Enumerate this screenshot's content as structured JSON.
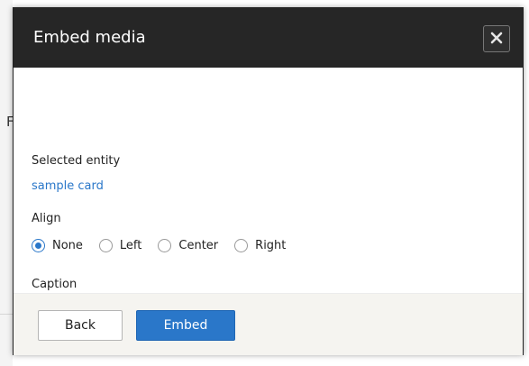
{
  "dialog": {
    "title": "Embed media",
    "close_label": "×"
  },
  "form": {
    "selected_entity_label": "Selected entity",
    "selected_entity_value": "sample card",
    "align_label": "Align",
    "align_options": [
      {
        "label": "None",
        "checked": true
      },
      {
        "label": "Left",
        "checked": false
      },
      {
        "label": "Center",
        "checked": false
      },
      {
        "label": "Right",
        "checked": false
      }
    ],
    "caption_label": "Caption",
    "caption_value": ""
  },
  "footer": {
    "back_label": "Back",
    "embed_label": "Embed"
  },
  "background": {
    "glyph": "F"
  },
  "colors": {
    "titlebar": "#262626",
    "accent": "#2a77c9",
    "footer_bg": "#f5f4f0"
  }
}
